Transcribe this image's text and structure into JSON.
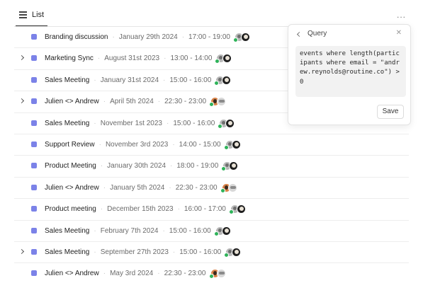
{
  "view": {
    "tab_label": "List",
    "more_label": "..."
  },
  "events": [
    {
      "title": "Branding discussion",
      "date": "January 29th 2024",
      "time": "17:00 - 19:00",
      "expandable": false,
      "avatars": [
        "person-photo",
        "person-photo"
      ]
    },
    {
      "title": "Marketing Sync",
      "date": "August 31st 2023",
      "time": "13:00 - 14:00",
      "expandable": true,
      "avatars": [
        "person-photo",
        "person-photo"
      ]
    },
    {
      "title": "Sales Meeting",
      "date": "January 31st 2024",
      "time": "15:00 - 16:00",
      "expandable": false,
      "avatars": [
        "person-photo",
        "person-photo"
      ]
    },
    {
      "title": "Julien <> Andrew",
      "date": "April 5th 2024",
      "time": "22:30 - 23:00",
      "expandable": true,
      "avatars": [
        "person-photo",
        "person-photo"
      ]
    },
    {
      "title": "Sales Meeting",
      "date": "November 1st 2023",
      "time": "15:00 - 16:00",
      "expandable": false,
      "avatars": [
        "person-photo",
        "person-photo"
      ]
    },
    {
      "title": "Support Review",
      "date": "November 3rd 2023",
      "time": "14:00 - 15:00",
      "expandable": false,
      "avatars": [
        "person-photo",
        "person-photo"
      ]
    },
    {
      "title": "Product Meeting",
      "date": "January 30th 2024",
      "time": "18:00 - 19:00",
      "expandable": false,
      "avatars": [
        "person-photo",
        "person-photo"
      ]
    },
    {
      "title": "Julien <> Andrew",
      "date": "January 5th 2024",
      "time": "22:30 - 23:00",
      "expandable": false,
      "avatars": [
        "person-photo",
        "person-photo"
      ]
    },
    {
      "title": "Product meeting",
      "date": "December 15th 2023",
      "time": "16:00 - 17:00",
      "expandable": false,
      "avatars": [
        "person-photo",
        "person-photo"
      ]
    },
    {
      "title": "Sales Meeting",
      "date": "February 7th 2024",
      "time": "15:00 - 16:00",
      "expandable": false,
      "avatars": [
        "person-photo",
        "person-photo"
      ]
    },
    {
      "title": "Sales Meeting",
      "date": "September 27th 2023",
      "time": "15:00 - 16:00",
      "expandable": true,
      "avatars": [
        "person-photo",
        "person-photo"
      ]
    },
    {
      "title": "Julien <> Andrew",
      "date": "May 3rd 2024",
      "time": "22:30 - 23:00",
      "expandable": false,
      "avatars": [
        "person-photo",
        "person-photo"
      ]
    }
  ],
  "query_panel": {
    "title": "Query",
    "query": "events where length(participants where email = \"andrew.reynolds@routine.co\") > 0",
    "save_label": "Save"
  },
  "colors": {
    "event_square": "#7b82e8",
    "status_check": "#2fb35a"
  }
}
